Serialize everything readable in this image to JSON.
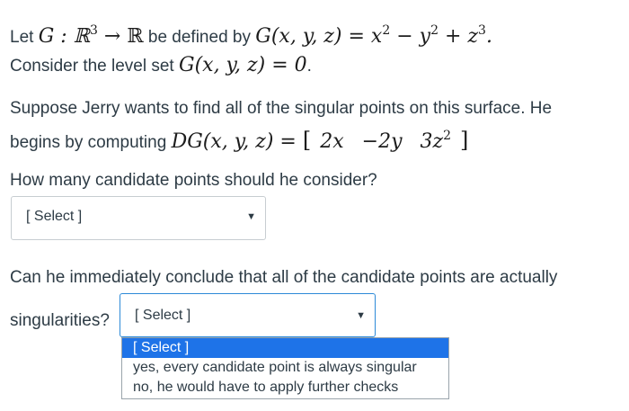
{
  "question1": {
    "intro_let": "Let",
    "G_colon": "G : ℝ",
    "exp3": "3",
    "arrow_R": "→ ℝ",
    "defined_by": "be defined by",
    "G_def": "G(x, y, z) = x",
    "exp2a": "2",
    "minus_y": "− y",
    "exp2b": "2",
    "plus_z": "+ z",
    "exp3b": "3",
    "period": ".",
    "consider": "Consider the level set",
    "level_set": "G(x, y, z) = 0",
    "period2": "."
  },
  "question2": {
    "line1": "Suppose Jerry wants to find all of the singular points on this surface. He",
    "line2_text": "begins by computing",
    "DG": "DG(x, y, z) =",
    "lbr": "[",
    "c1": "2x",
    "c2": "−2y",
    "c3": "3z",
    "c3_exp": "2",
    "rbr": "]",
    "prompt": "How many candidate points should he consider?"
  },
  "select1": {
    "value": "[ Select ]",
    "arrow": "▼"
  },
  "question3": {
    "line1": "Can he immediately conclude that all of the candidate points are actually",
    "line2": "singularities?"
  },
  "select2": {
    "value": "[ Select ]",
    "arrow": "▼",
    "options": [
      "[ Select ]",
      "yes, every candidate point is always singular",
      "no, he would have to apply further checks"
    ]
  }
}
